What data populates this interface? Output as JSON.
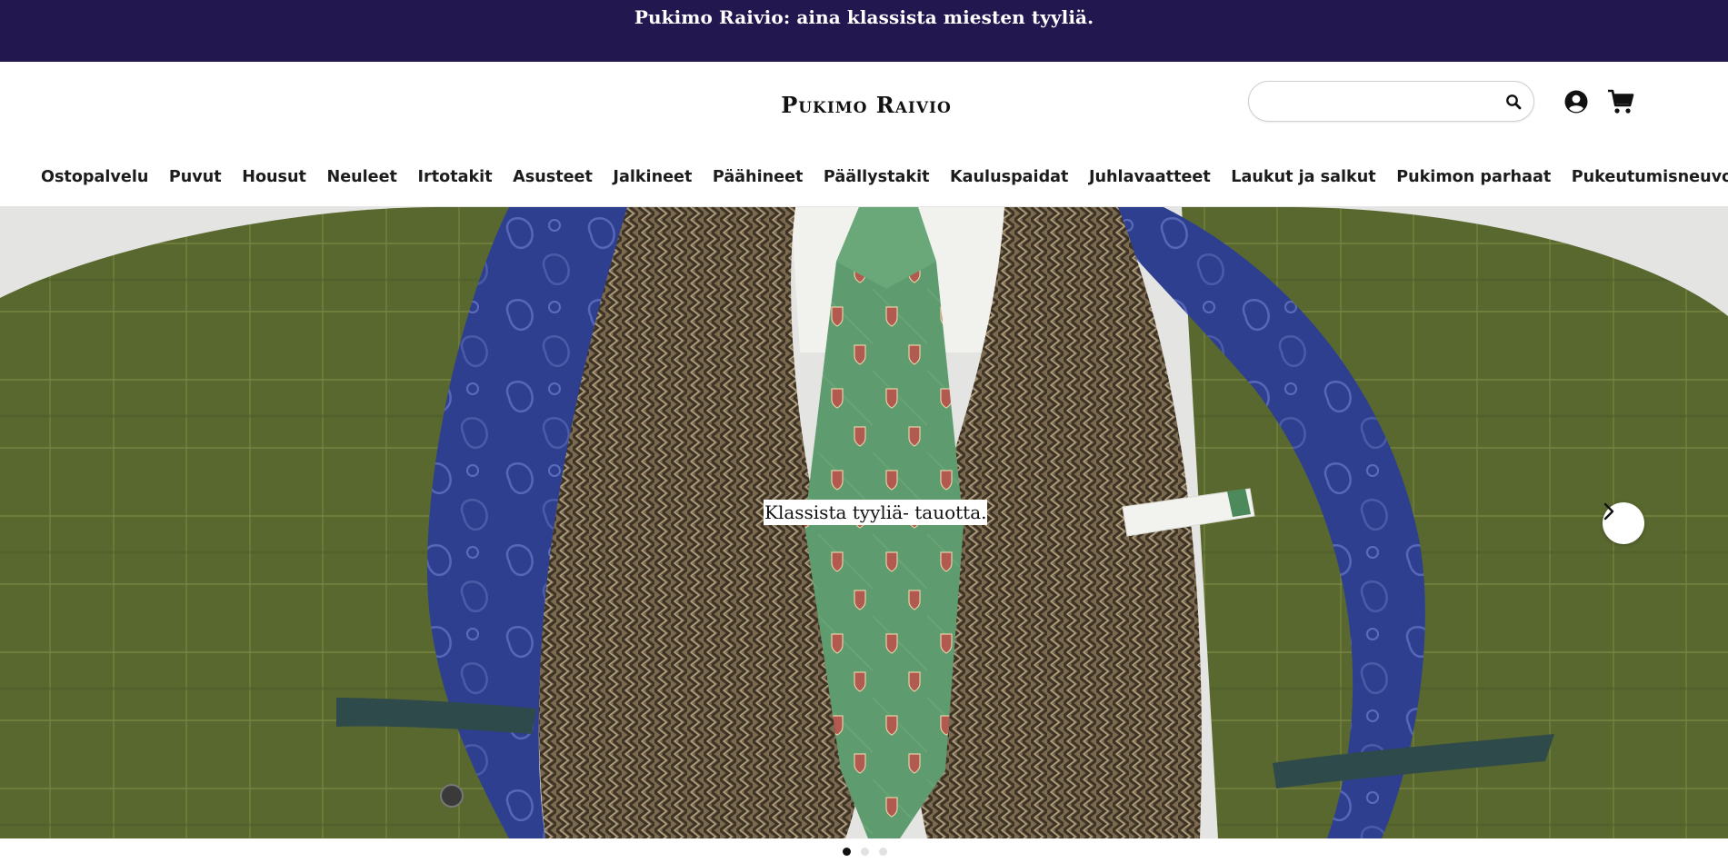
{
  "announcement": {
    "text": "Pukimo Raivio: aina klassista miesten tyyliä."
  },
  "header": {
    "logo": "Pukimo Raivio",
    "search": {
      "value": "",
      "placeholder": ""
    },
    "icons": {
      "search": "search-icon",
      "account": "account-icon",
      "cart": "cart-icon"
    }
  },
  "nav": {
    "items": [
      "Ostopalvelu",
      "Puvut",
      "Housut",
      "Neuleet",
      "Irtotakit",
      "Asusteet",
      "Jalkineet",
      "Päähineet",
      "Päällystakit",
      "Kauluspaidat",
      "Juhlavaatteet",
      "Laukut ja salkut",
      "Pukimon parhaat",
      "Pukeutumisneuvonta"
    ]
  },
  "hero": {
    "caption": "Klassista tyyliä- tauotta.",
    "next_icon": "chevron-right-icon",
    "slides": {
      "count": 3,
      "active": 1
    }
  },
  "colors": {
    "announcement_bg": "#23174f",
    "jacket": "#5a6b2e",
    "lining": "#2e3f8f",
    "tie": "#5e9b6e",
    "waistcoat": "#7d6a4e"
  }
}
